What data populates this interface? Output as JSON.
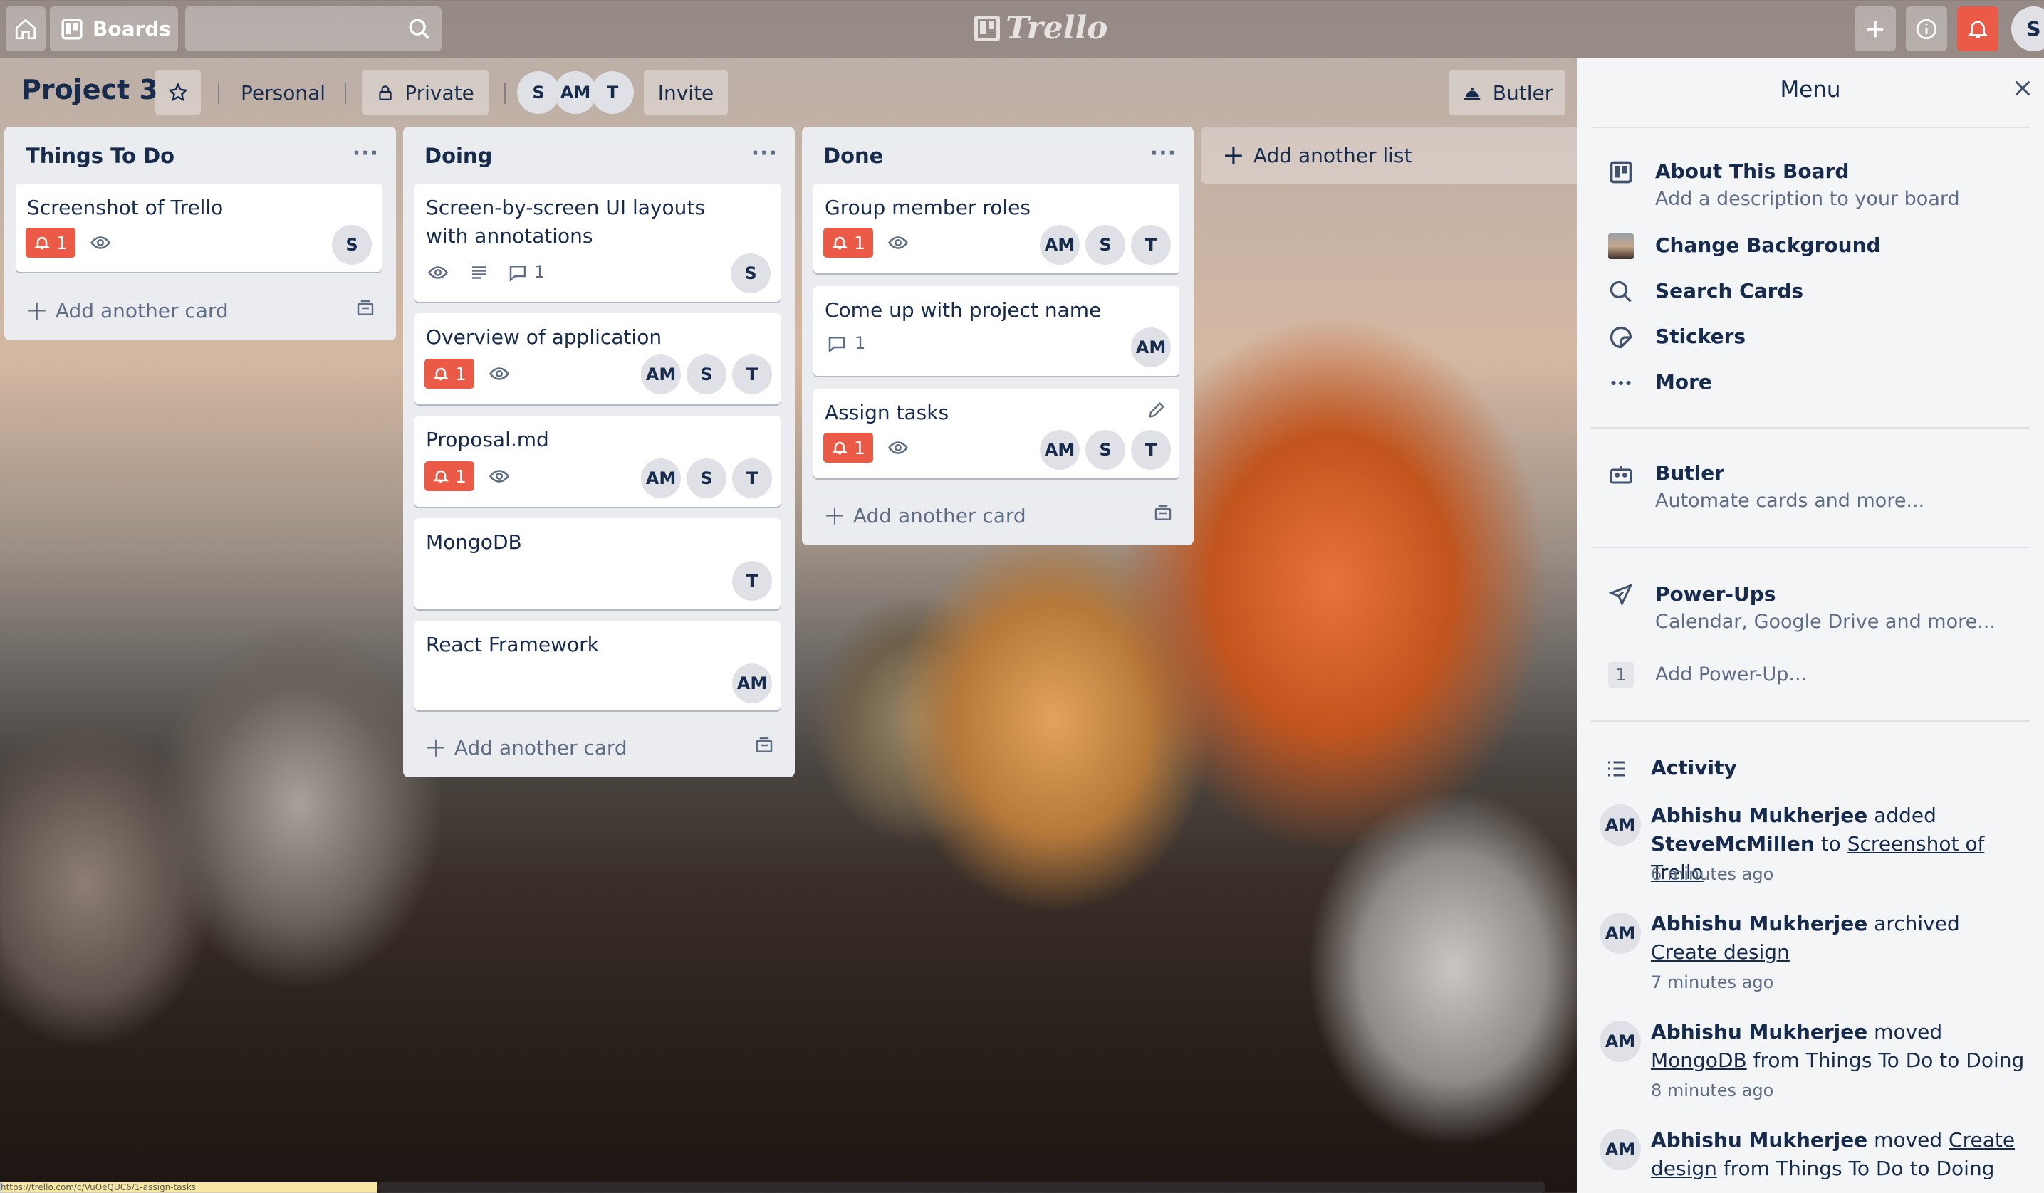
{
  "topbar": {
    "boards_label": "Boards",
    "search_placeholder": "",
    "logo_text": "Trello",
    "user_initial": "S"
  },
  "board": {
    "title": "Project 3",
    "team": "Personal",
    "visibility": "Private",
    "members": [
      "S",
      "AM",
      "T"
    ],
    "invite": "Invite",
    "butler": "Butler"
  },
  "lists": [
    {
      "title": "Things To Do",
      "menu": "···",
      "add_card": "Add another card",
      "cards": [
        {
          "title": "Screenshot of Trello",
          "due": "1",
          "members": [
            "S"
          ]
        }
      ]
    },
    {
      "title": "Doing",
      "menu": "···",
      "add_card": "Add another card",
      "cards": [
        {
          "title": "Screen-by-screen UI layouts with annotations",
          "comments": "1",
          "members": [
            "S"
          ]
        },
        {
          "title": "Overview of application",
          "due": "1",
          "members": [
            "AM",
            "S",
            "T"
          ]
        },
        {
          "title": "Proposal.md",
          "due": "1",
          "members": [
            "AM",
            "S",
            "T"
          ]
        },
        {
          "title": "MongoDB",
          "members": [
            "T"
          ]
        },
        {
          "title": "React Framework",
          "members": [
            "AM"
          ]
        }
      ]
    },
    {
      "title": "Done",
      "menu": "···",
      "add_card": "Add another card",
      "cards": [
        {
          "title": "Group member roles",
          "due": "1",
          "members": [
            "AM",
            "S",
            "T"
          ]
        },
        {
          "title": "Come up with project name",
          "comments": "1",
          "members": [
            "AM"
          ]
        },
        {
          "title": "Assign tasks",
          "due": "1",
          "members": [
            "AM",
            "S",
            "T"
          ]
        }
      ]
    }
  ],
  "add_list": "Add another list",
  "menu": {
    "title": "Menu",
    "about_title": "About This Board",
    "about_sub": "Add a description to your board",
    "change_bg": "Change Background",
    "search_cards": "Search Cards",
    "stickers": "Stickers",
    "more": "More",
    "butler_title": "Butler",
    "butler_sub": "Automate cards and more...",
    "powerups_title": "Power-Ups",
    "powerups_sub": "Calendar, Google Drive and more...",
    "powerups_count": "1",
    "add_powerup": "Add Power-Up...",
    "activity_title": "Activity",
    "activity": [
      {
        "avatar": "AM",
        "user": "Abhishu Mukherjee",
        "verb": " added ",
        "obj": "SteveMcMillen",
        "mid": " to ",
        "link": "Screenshot of Trello",
        "tail": "",
        "time": "6 minutes ago"
      },
      {
        "avatar": "AM",
        "user": "Abhishu Mukherjee",
        "verb": " archived ",
        "obj": "",
        "mid": "",
        "link": "Create design",
        "tail": "",
        "time": "7 minutes ago"
      },
      {
        "avatar": "AM",
        "user": "Abhishu Mukherjee",
        "verb": " moved ",
        "obj": "",
        "mid": "",
        "link": "MongoDB",
        "tail": " from Things To Do to Doing",
        "time": "8 minutes ago"
      },
      {
        "avatar": "AM",
        "user": "Abhishu Mukherjee",
        "verb": " moved ",
        "obj": "",
        "mid": "",
        "link": "Create design",
        "tail": " from Things To Do to Doing",
        "time": ""
      }
    ]
  },
  "status_url": "https://trello.com/c/VuOeQUC6/1-assign-tasks"
}
